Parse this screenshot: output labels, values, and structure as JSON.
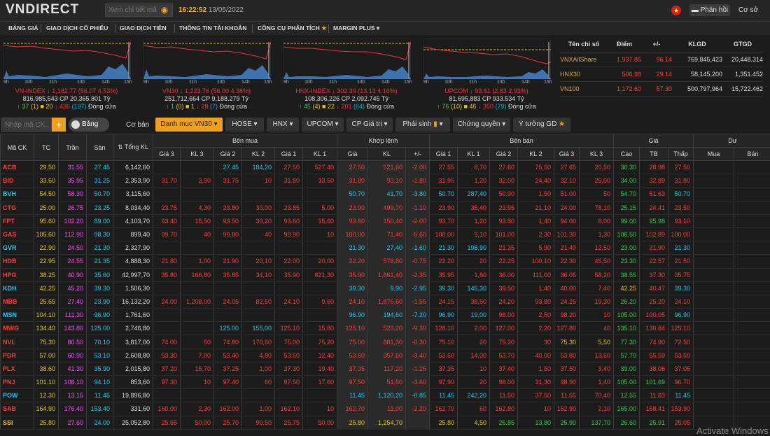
{
  "header": {
    "logo": "VNDIRECT",
    "search_placeholder": "Xem chỉ tiết mã",
    "time": "16:22:52",
    "date": "13/05/2022",
    "feedback": "Phản hồi",
    "account": "Cơ sở"
  },
  "nav": [
    "BẢNG GIÁ",
    "GIAO DỊCH CỔ PHIẾU",
    "GIAO DỊCH TIỀN",
    "THÔNG TIN TÀI KHOẢN",
    "CÔNG CỤ PHÂN TÍCH",
    "MARGIN PLUS"
  ],
  "charts": [
    {
      "axis": [
        "9h",
        "10h",
        "11h",
        "13h",
        "14h",
        "15h"
      ],
      "line1": "VN-INDEX ↓ 1,182.77 (56.07 4.53%)",
      "line2": "816,985,543 CP 20,365.801 Tỷ",
      "up": "↑ 37",
      "ref": "(1)",
      "refn": "■ 20",
      "dn": "↓ 436",
      "fl": "(197)",
      "status": "Đóng cửa"
    },
    {
      "axis": [
        "9h",
        "10h",
        "11h",
        "13h",
        "14h",
        "15h"
      ],
      "line1": "VN30 ↓ 1,223.76 (56.00 4.38%)",
      "line2": "251,712,664 CP 9,188.279 Tỷ",
      "up": "↑ 1",
      "ref": "(0)",
      "refn": "■ 1",
      "dn": "↓ 28",
      "fl": "(7)",
      "status": "Đóng cửa"
    },
    {
      "axis": [
        "9h",
        "10h",
        "11h",
        "13h",
        "14h",
        "15h"
      ],
      "line1": "HNX-INDEX ↓ 302.39 (13.13 4.16%)",
      "line2": "108,306,226 CP 2,092.745 Tỷ",
      "up": "↑ 45",
      "ref": "(4)",
      "refn": "■ 22",
      "dn": "↓ 201",
      "fl": "(64)",
      "status": "Đóng cửa"
    },
    {
      "axis": [
        "9h",
        "10h",
        "11h",
        "13h",
        "14h",
        "15h"
      ],
      "line1": "UPCOM ↓ 93.61 (2.83 2.93%)",
      "line2": "81,695,883 CP 933.534 Tỷ",
      "up": "↑ 76",
      "ref": "(10)",
      "refn": "■ 46",
      "dn": "↓ 350",
      "fl": "(79)",
      "status": "Đóng cửa"
    }
  ],
  "index_table": {
    "headers": [
      "Tên chỉ số",
      "Điểm",
      "+/-",
      "KLGD",
      "GTGD"
    ],
    "rows": [
      [
        "VNXAllShare",
        "1,937.85",
        "96.14",
        "769,845,423",
        "20,448.314"
      ],
      [
        "HNX30",
        "506.98",
        "29.14",
        "58,145,200",
        "1,351.452"
      ],
      [
        "VN100",
        "1,172.60",
        "57.30",
        "500,797,964",
        "15,722.462"
      ]
    ]
  },
  "filter": {
    "placeholder": "Nhập mã CK...",
    "add": "+",
    "toggle": "Bảng giá",
    "basic": "Cơ bản",
    "tabs": [
      "Danh mục VN30",
      "HOSE",
      "HNX",
      "UPCOM",
      "CP Giá trị",
      "Phái sinh",
      "Chứng quyền",
      "Ý tưởng GD"
    ]
  },
  "board_headers": {
    "top": [
      "Mã CK",
      "TC",
      "Trần",
      "Sàn",
      "Tổng KL",
      "Bên mua",
      "Khớp lệnh",
      "Bên bán",
      "Giá",
      "Dư"
    ],
    "sub": [
      "Giá 3",
      "KL 3",
      "Giá 2",
      "KL 2",
      "Giá 1",
      "KL 1",
      "Giá",
      "KL",
      "+/-",
      "Giá 1",
      "KL 1",
      "Giá 2",
      "KL 2",
      "Giá 3",
      "KL 3",
      "Cao",
      "TB",
      "Thấp",
      "Mua",
      "Bán"
    ]
  },
  "rows": [
    [
      "ACB",
      "29.50",
      "31.55",
      "27.45",
      "6,142,60",
      "",
      "",
      "27.45",
      "184,20",
      "27.50",
      "527,40",
      "27.50",
      "521,60",
      "-2.00",
      "27.55",
      "8,70",
      "27.60",
      "75,50",
      "27.65",
      "20,50",
      "30.30",
      "28.98",
      "27.50",
      "",
      ""
    ],
    [
      "BID",
      "33.60",
      "35.95",
      "31.25",
      "2,353,90",
      "31.70",
      "3,90",
      "31.75",
      "10",
      "31.80",
      "33,50",
      "31.80",
      "93,10",
      "-1.80",
      "31.95",
      "1,20",
      "32.00",
      "24,40",
      "32.10",
      "25,00",
      "34.00",
      "32.89",
      "31.80",
      "",
      ""
    ],
    [
      "BVH",
      "54.50",
      "58.30",
      "50.70",
      "3,115,60",
      "",
      "",
      "",
      "",
      "",
      "",
      "50.70",
      "41,70",
      "-3.80",
      "50.70",
      "287,40",
      "50.90",
      "1,50",
      "51.00",
      "50",
      "54.70",
      "51.63",
      "50.70",
      "",
      ""
    ],
    [
      "CTG",
      "25.00",
      "26.75",
      "23.25",
      "8,034,40",
      "23.75",
      "4,30",
      "23.80",
      "30,00",
      "23.85",
      "5,00",
      "23.90",
      "499,70",
      "-1.10",
      "23.90",
      "35,40",
      "23.95",
      "21,10",
      "24.00",
      "78,10",
      "25.15",
      "24.41",
      "23.50",
      "",
      ""
    ],
    [
      "FPT",
      "95.60",
      "102.20",
      "89.00",
      "4,103,70",
      "93.40",
      "15,50",
      "93.50",
      "30,20",
      "93.60",
      "15,60",
      "93.60",
      "150,40",
      "-2.00",
      "93.70",
      "1,20",
      "93.80",
      "1,40",
      "94.00",
      "6,00",
      "99.00",
      "95.98",
      "93.10",
      "",
      ""
    ],
    [
      "GAS",
      "105.60",
      "112.90",
      "98.30",
      "899,40",
      "99.70",
      "40",
      "99.80",
      "40",
      "99.90",
      "10",
      "100.00",
      "71,40",
      "-5.60",
      "100.00",
      "5,10",
      "101.00",
      "2,30",
      "101.30",
      "1,30",
      "106.50",
      "102.89",
      "100.00",
      "",
      ""
    ],
    [
      "GVR",
      "22.90",
      "24.50",
      "21.30",
      "2,327,90",
      "",
      "",
      "",
      "",
      "",
      "",
      "21.30",
      "27,40",
      "-1.60",
      "21.30",
      "198,90",
      "21.35",
      "5,90",
      "21.40",
      "12,50",
      "23.00",
      "21.90",
      "21.30",
      "",
      ""
    ],
    [
      "HDB",
      "22.95",
      "24.55",
      "21.35",
      "4,888,30",
      "21.80",
      "1,00",
      "21.90",
      "20,10",
      "22.00",
      "20,00",
      "22.20",
      "578,80",
      "-0.75",
      "22.20",
      "20",
      "22.25",
      "100,10",
      "22.30",
      "45,50",
      "23.30",
      "22.57",
      "21.50",
      "",
      ""
    ],
    [
      "HPG",
      "38.25",
      "40.90",
      "35.60",
      "42,997,70",
      "35.80",
      "166,80",
      "35.85",
      "34,10",
      "35.90",
      "821,30",
      "35.90",
      "1,861,40",
      "-2.35",
      "35.95",
      "1,80",
      "36.00",
      "111,00",
      "36.05",
      "58,20",
      "38.55",
      "37.30",
      "35.75",
      "",
      ""
    ],
    [
      "KDH",
      "42.25",
      "45.20",
      "39.30",
      "1,506,30",
      "",
      "",
      "",
      "",
      "",
      "",
      "39.30",
      "9,90",
      "-2.95",
      "39.30",
      "145,30",
      "39.50",
      "1,40",
      "40.00",
      "7,40",
      "42.25",
      "40.47",
      "39.30",
      "",
      ""
    ],
    [
      "MBB",
      "25.65",
      "27.40",
      "23.90",
      "16,132,20",
      "24.00",
      "1,208,00",
      "24.05",
      "82,50",
      "24.10",
      "9,60",
      "24.10",
      "1,876,60",
      "-1.55",
      "24.15",
      "38,50",
      "24.20",
      "93,80",
      "24.25",
      "19,30",
      "26.20",
      "25.20",
      "24.10",
      "",
      ""
    ],
    [
      "MSN",
      "104.10",
      "111.30",
      "96.90",
      "1,761,60",
      "",
      "",
      "",
      "",
      "",
      "",
      "96.90",
      "194,60",
      "-7.20",
      "96.90",
      "19,00",
      "98.00",
      "2,50",
      "98.20",
      "10",
      "105.00",
      "100.05",
      "96.90",
      "",
      ""
    ],
    [
      "MWG",
      "134.40",
      "143.80",
      "125.00",
      "2,746,80",
      "",
      "",
      "125.00",
      "155,00",
      "125.10",
      "15,80",
      "125.10",
      "523,20",
      "-9.30",
      "126.10",
      "2,00",
      "127.00",
      "2,20",
      "127.80",
      "40",
      "135.10",
      "130.84",
      "125.10",
      "",
      ""
    ],
    [
      "NVL",
      "75.30",
      "80.50",
      "70.10",
      "3,817,00",
      "74.00",
      "50",
      "74.80",
      "170,50",
      "75.00",
      "75,20",
      "75.00",
      "881,30",
      "-0.30",
      "75.10",
      "20",
      "75.20",
      "30",
      "75.30",
      "5,50",
      "77.30",
      "74.90",
      "72.50",
      "",
      ""
    ],
    [
      "PDR",
      "57.00",
      "60.90",
      "53.10",
      "2,608,80",
      "53.30",
      "7,00",
      "53.40",
      "4,80",
      "53.50",
      "12,40",
      "53.60",
      "357,60",
      "-3.40",
      "53.60",
      "14,00",
      "53.70",
      "40,00",
      "53.80",
      "13,60",
      "57.70",
      "55.59",
      "53.50",
      "",
      ""
    ],
    [
      "PLX",
      "38.60",
      "41.30",
      "35.90",
      "2,015,80",
      "37.20",
      "15,70",
      "37.25",
      "1,00",
      "37.30",
      "19,40",
      "37.35",
      "117,20",
      "-1.25",
      "37.35",
      "10",
      "37.40",
      "1,50",
      "37.50",
      "3,40",
      "39.00",
      "38.06",
      "37.05",
      "",
      ""
    ],
    [
      "PNJ",
      "101.10",
      "108.10",
      "94.10",
      "853,60",
      "97.30",
      "10",
      "97.40",
      "60",
      "97.50",
      "17,60",
      "97.50",
      "51,50",
      "-3.60",
      "97.90",
      "20",
      "98.00",
      "31,30",
      "98.90",
      "1,40",
      "105.00",
      "101.69",
      "96.70",
      "",
      ""
    ],
    [
      "POW",
      "12.30",
      "13.15",
      "11.45",
      "19,896,80",
      "",
      "",
      "",
      "",
      "",
      "",
      "11.45",
      "1,120,20",
      "-0.85",
      "11.45",
      "242,20",
      "11.50",
      "37,50",
      "11.55",
      "70,40",
      "12.55",
      "11.83",
      "11.45",
      "",
      ""
    ],
    [
      "SAB",
      "164.90",
      "176.40",
      "153.40",
      "331,60",
      "160.00",
      "2,30",
      "162.00",
      "1,00",
      "162.10",
      "10",
      "162.70",
      "11,00",
      "-2.20",
      "162.70",
      "60",
      "162.80",
      "10",
      "162.90",
      "2,10",
      "165.00",
      "158.41",
      "153.90",
      "",
      ""
    ],
    [
      "SSI",
      "25.80",
      "27.60",
      "24.00",
      "25,052,80",
      "25.65",
      "50,00",
      "25.70",
      "90,50",
      "25.75",
      "50,00",
      "25.80",
      "1,254,70",
      "",
      "25.80",
      "4,50",
      "25.85",
      "13,80",
      "25.90",
      "137,70",
      "26.60",
      "25.91",
      "25.05",
      "",
      ""
    ]
  ],
  "colors": {
    "up": "#2ecc40",
    "down": "#ff3b30",
    "ref": "#e8c020",
    "ceiling": "#ff44ff",
    "floor": "#1ec8f0",
    "accent": "#f0a020"
  },
  "watermark": "Activate Windows"
}
